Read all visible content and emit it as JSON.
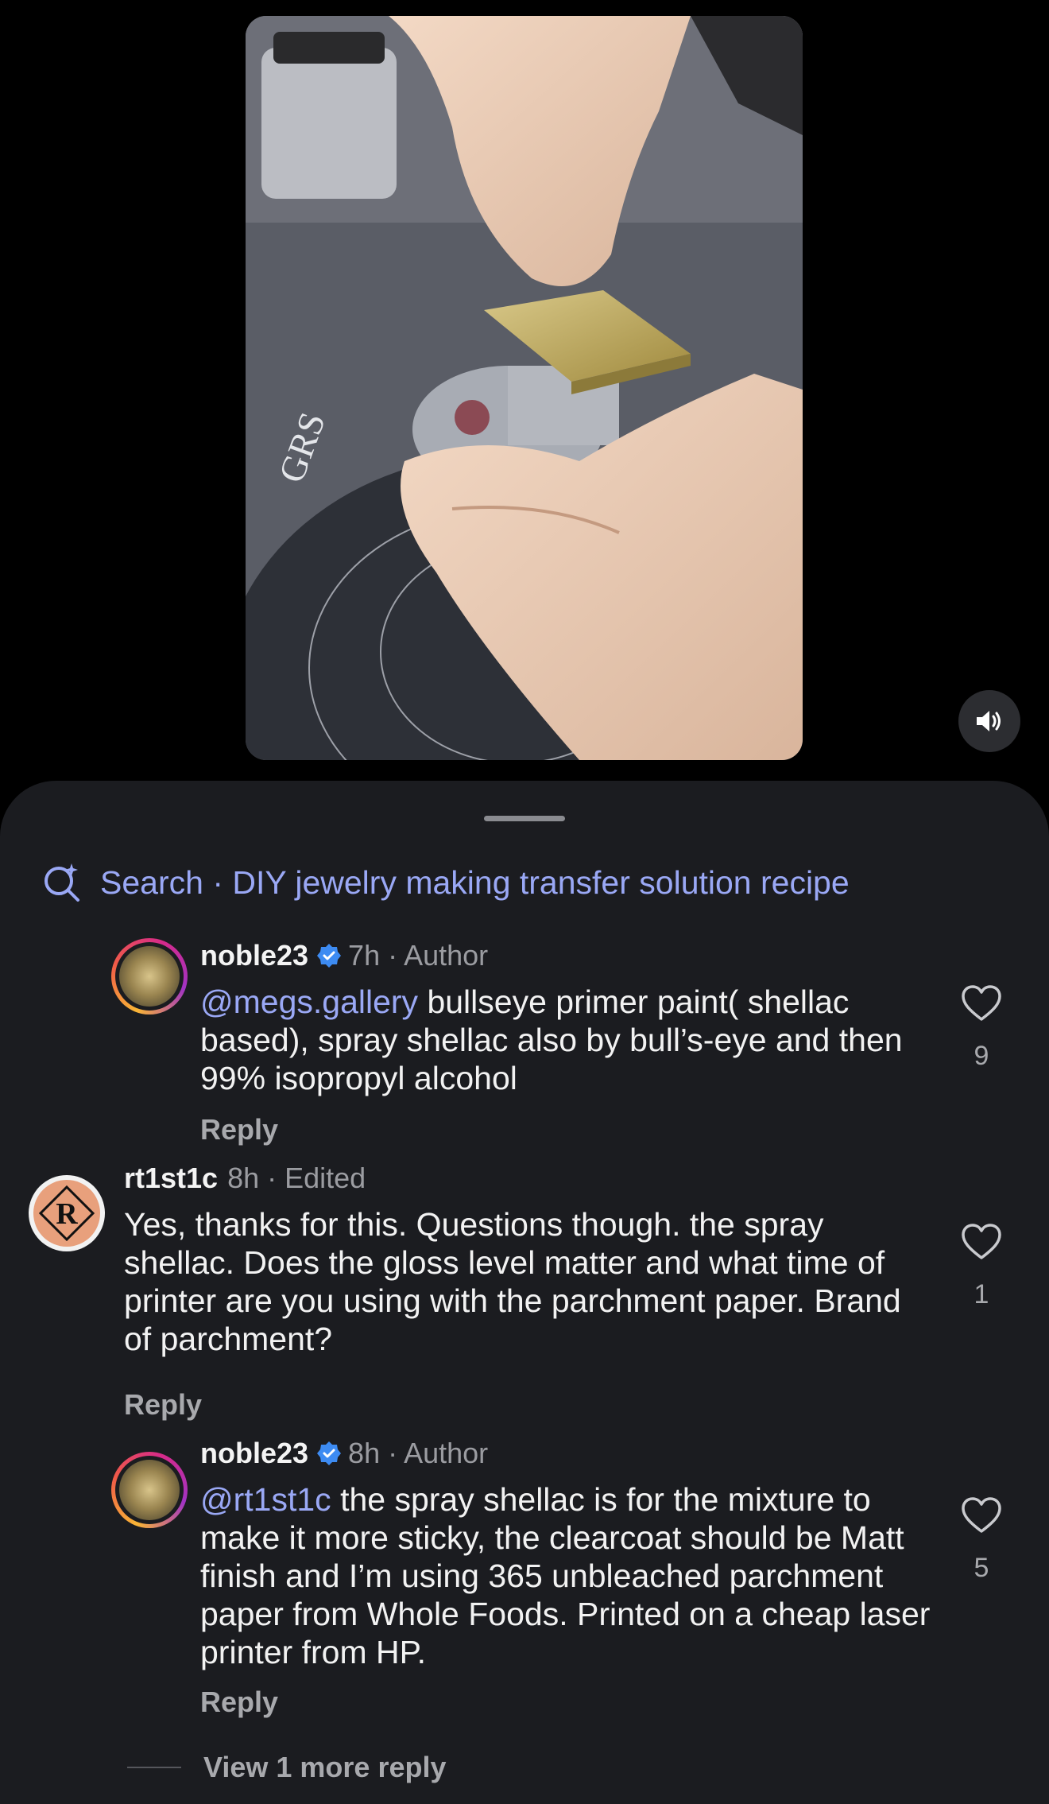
{
  "search": {
    "prefix": "Search",
    "separator": " · ",
    "query": "DIY jewelry making transfer solution recipe"
  },
  "comments": [
    {
      "username": "noble23",
      "verified": true,
      "meta": "7h · Author",
      "mention": "@megs.gallery",
      "text": " bullseye primer paint( shellac based), spray shellac also by bull’s-eye and then 99% isopropyl alcohol",
      "reply_label": "Reply",
      "likes": "9"
    },
    {
      "username": "rt1st1c",
      "verified": false,
      "meta": "8h · Edited",
      "mention": "",
      "text": "Yes, thanks for this. Questions though. the spray shellac. Does the gloss level matter and what time of printer are you using with the parchment paper. Brand of parchment?",
      "reply_label": "Reply",
      "likes": "1"
    },
    {
      "username": "noble23",
      "verified": true,
      "meta": "8h · Author",
      "mention": "@rt1st1c",
      "text": " the spray shellac is for the mixture to make it more sticky, the clearcoat should be Matt finish and I’m using 365 unbleached parchment paper from Whole Foods. Printed on a cheap laser printer from HP.",
      "reply_label": "Reply",
      "likes": "5"
    }
  ],
  "view_more": "View 1 more reply",
  "colors": {
    "background": "#000000",
    "sheet": "#1b1c20",
    "accent_link": "#9aa8f5",
    "verified": "#3d8bf2",
    "muted": "#a8a9ad"
  },
  "icons": {
    "search": "ai-search-sparkle-icon",
    "mute": "speaker-volume-icon",
    "like": "heart-outline-icon",
    "verified": "verified-badge-icon"
  }
}
